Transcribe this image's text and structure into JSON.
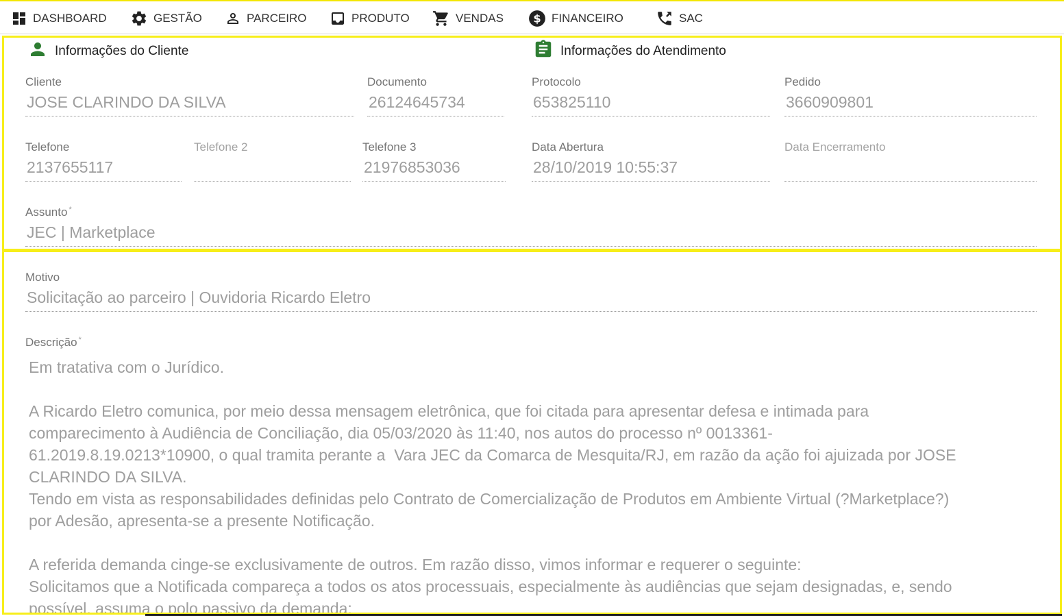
{
  "nav": {
    "items": [
      {
        "label": "DASHBOARD",
        "icon": "dashboard-icon"
      },
      {
        "label": "GESTÃO",
        "icon": "gear-icon"
      },
      {
        "label": "PARCEIRO",
        "icon": "person-icon"
      },
      {
        "label": "PRODUTO",
        "icon": "inbox-icon"
      },
      {
        "label": "VENDAS",
        "icon": "cart-icon"
      },
      {
        "label": "FINANCEIRO",
        "icon": "dollar-icon"
      },
      {
        "label": "SAC",
        "icon": "phone-icon"
      }
    ]
  },
  "colors": {
    "highlight": "#f7ee1a",
    "section_icon": "#2e7d32",
    "value_text": "#9e9e9e"
  },
  "client_section": {
    "title": "Informações do Cliente",
    "icon": "person-icon",
    "cliente": {
      "label": "Cliente",
      "value": "JOSE CLARINDO DA SILVA"
    },
    "documento": {
      "label": "Documento",
      "value": "26124645734"
    },
    "telefone": {
      "label": "Telefone",
      "value": "2137655117"
    },
    "telefone2": {
      "label": "Telefone 2",
      "value": ""
    },
    "telefone3": {
      "label": "Telefone 3",
      "value": "21976853036"
    },
    "assunto": {
      "label": "Assunto",
      "required": "*",
      "value": "JEC | Marketplace"
    }
  },
  "service_section": {
    "title": "Informações do Atendimento",
    "icon": "assignment-icon",
    "protocolo": {
      "label": "Protocolo",
      "value": "653825110"
    },
    "pedido": {
      "label": "Pedido",
      "value": "3660909801"
    },
    "data_abertura": {
      "label": "Data Abertura",
      "value": "28/10/2019 10:55:37"
    },
    "data_encerramento": {
      "label": "Data Encerramento",
      "value": ""
    }
  },
  "motivo": {
    "label": "Motivo",
    "value": "Solicitação ao parceiro | Ouvidoria Ricardo Eletro"
  },
  "descricao": {
    "label": "Descrição",
    "required": "*",
    "text": "Em tratativa com o Jurídico.\n\nA Ricardo Eletro comunica, por meio dessa mensagem eletrônica, que foi citada para apresentar defesa e intimada para\ncomparecimento à Audiência de Conciliação, dia 05/03/2020 às 11:40, nos autos do processo nº 0013361-\n61.2019.8.19.0213*10900, o qual tramita perante a  Vara JEC da Comarca de Mesquita/RJ, em razão da ação foi ajuizada por JOSE\nCLARINDO DA SILVA.\nTendo em vista as responsabilidades definidas pelo Contrato de Comercialização de Produtos em Ambiente Virtual (?Marketplace?)\npor Adesão, apresenta-se a presente Notificação.\n\nA referida demanda cinge-se exclusivamente de outros. Em razão disso, vimos informar e requerer o seguinte:\nSolicitamos que a Notificada compareça a todos os atos processuais, especialmente às audiências que sejam designadas, e, sendo\npossível, assuma o polo passivo da demanda;"
  }
}
